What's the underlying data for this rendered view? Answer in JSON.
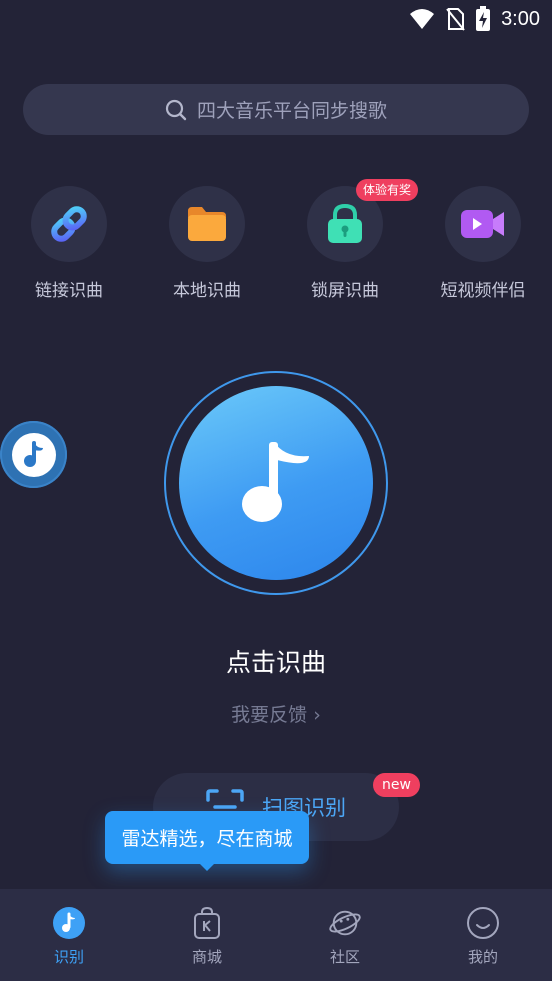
{
  "status_bar": {
    "time": "3:00"
  },
  "search": {
    "placeholder": "四大音乐平台同步搜歌"
  },
  "features": [
    {
      "label": "链接识曲",
      "icon": "link-icon"
    },
    {
      "label": "本地识曲",
      "icon": "folder-icon"
    },
    {
      "label": "锁屏识曲",
      "icon": "lock-icon",
      "badge": "体验有奖"
    },
    {
      "label": "短视频伴侣",
      "icon": "video-icon"
    }
  ],
  "main": {
    "title": "点击识曲",
    "feedback": "我要反馈 ›"
  },
  "scan": {
    "label": "扫图识别",
    "badge": "new"
  },
  "tooltip": {
    "text": "雷达精选，尽在商城"
  },
  "nav": [
    {
      "label": "识别",
      "icon": "music-note-icon",
      "active": true
    },
    {
      "label": "商城",
      "icon": "shop-bag-icon"
    },
    {
      "label": "社区",
      "icon": "planet-icon"
    },
    {
      "label": "我的",
      "icon": "smiley-icon"
    }
  ],
  "colors": {
    "background": "#232337",
    "accent": "#3ea1f6",
    "badge": "#ef3f5f"
  }
}
